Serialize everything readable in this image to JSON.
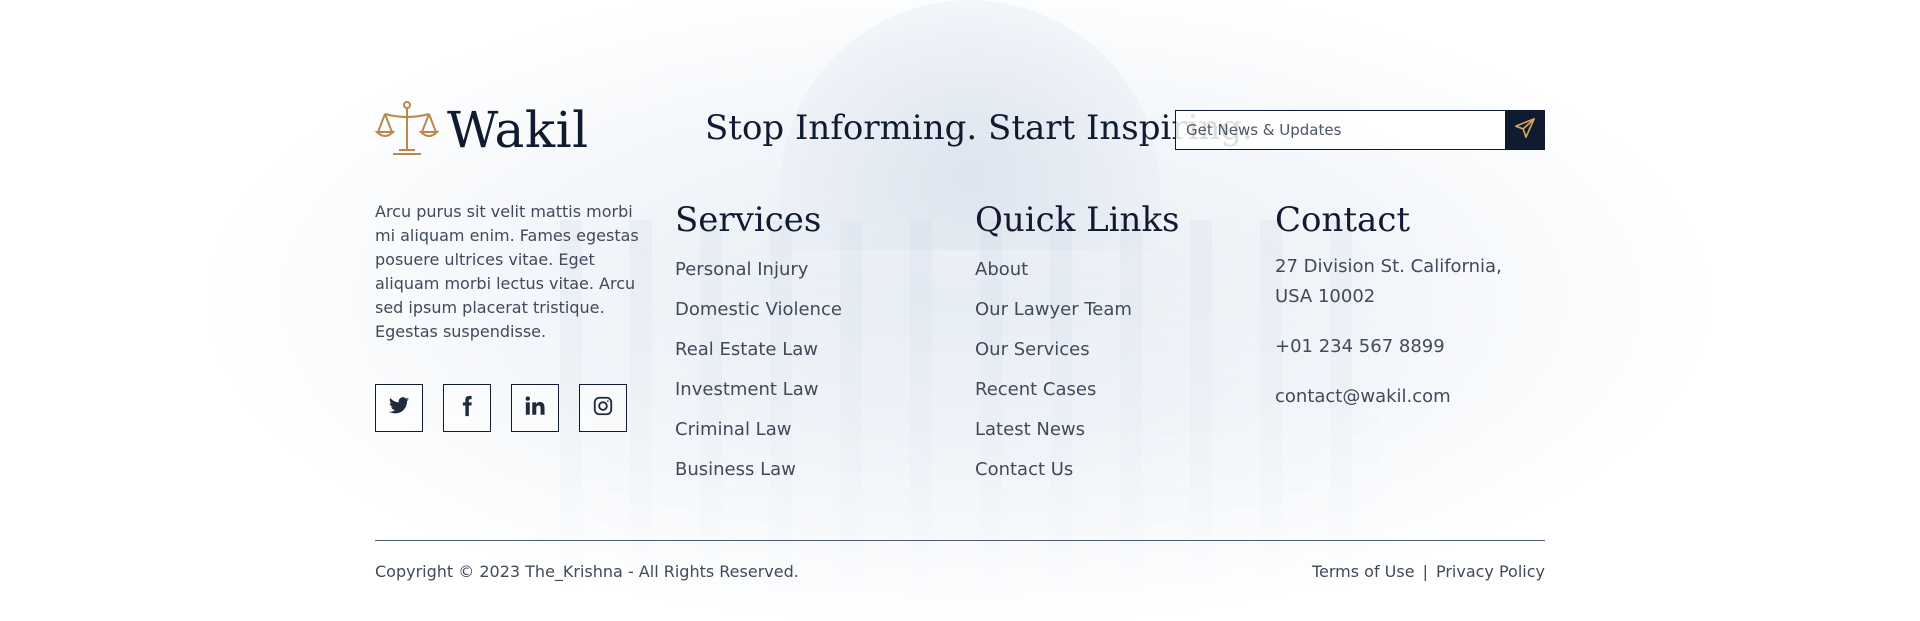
{
  "brand": {
    "name": "Wakil",
    "logo_icon": "scales-of-justice-icon",
    "accent_color": "#b8894a"
  },
  "tagline": "Stop Informing. Start Inspiring.",
  "newsletter": {
    "placeholder": "Get News & Updates",
    "submit_icon": "paper-plane-icon"
  },
  "about": {
    "text": "Arcu purus sit velit mattis morbi mi aliquam enim. Fames egestas posuere ultrices vitae. Eget aliquam morbi lectus vitae. Arcu sed ipsum placerat tristique. Egestas suspendisse."
  },
  "social": [
    {
      "icon": "twitter-icon"
    },
    {
      "icon": "facebook-icon"
    },
    {
      "icon": "linkedin-icon"
    },
    {
      "icon": "instagram-icon"
    }
  ],
  "services": {
    "title": "Services",
    "items": [
      "Personal Injury",
      "Domestic Violence",
      "Real Estate Law",
      "Investment Law",
      "Criminal Law",
      "Business Law"
    ]
  },
  "quick_links": {
    "title": "Quick Links",
    "items": [
      "About",
      "Our Lawyer Team",
      "Our Services",
      "Recent Cases",
      "Latest News",
      "Contact Us"
    ]
  },
  "contact": {
    "title": "Contact",
    "address_line1": "27 Division St. California,",
    "address_line2": "USA 10002",
    "phone": "+01 234 567 8899",
    "email": "contact@wakil.com"
  },
  "bottom": {
    "copyright": "Copyright © 2023 The_Krishna - All Rights Reserved.",
    "terms": "Terms of Use",
    "separator": "|",
    "privacy": "Privacy Policy"
  },
  "colors": {
    "navy": "#0f1b30",
    "text": "#3f4a5a"
  }
}
